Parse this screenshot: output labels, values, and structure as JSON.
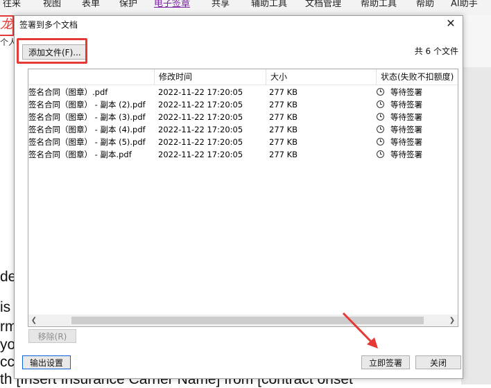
{
  "background": {
    "menu": [
      "往来",
      "视图",
      "表单",
      "保护",
      "电子签章",
      "共享",
      "辅助工具",
      "文档管理",
      "帮助工具",
      "帮助",
      "AI助手"
    ],
    "active_menu": "电子签章",
    "logo_char": "龙",
    "side_text": "个人",
    "doc_lines": [
      "de",
      "is t",
      "rm",
      "yo",
      "cc",
      "th [Insert Insurance Carrier Name] from [contract onset"
    ]
  },
  "dialog": {
    "title": "签署到多个文档",
    "add_file_label": "添加文件(F)...",
    "file_count": "共 6 个文件",
    "columns": [
      "",
      "修改时间",
      "大小",
      "状态(失败不扣额度)"
    ],
    "files": [
      {
        "name": "签名合同（图章）.pdf",
        "mtime": "2022-11-22 17:20:05",
        "size": "277 KB",
        "status": "等待签署"
      },
      {
        "name": "签名合同（图章） - 副本 (2).pdf",
        "mtime": "2022-11-22 17:20:05",
        "size": "277 KB",
        "status": "等待签署"
      },
      {
        "name": "签名合同（图章） - 副本 (3).pdf",
        "mtime": "2022-11-22 17:20:05",
        "size": "277 KB",
        "status": "等待签署"
      },
      {
        "name": "签名合同（图章） - 副本 (4).pdf",
        "mtime": "2022-11-22 17:20:05",
        "size": "277 KB",
        "status": "等待签署"
      },
      {
        "name": "签名合同（图章） - 副本 (5).pdf",
        "mtime": "2022-11-22 17:20:05",
        "size": "277 KB",
        "status": "等待签署"
      },
      {
        "name": "签名合同（图章） - 副本.pdf",
        "mtime": "2022-11-22 17:20:05",
        "size": "277 KB",
        "status": "等待签署"
      }
    ],
    "remove_label": "移除(R)",
    "output_settings_label": "输出设置",
    "sign_now_label": "立即签署",
    "close_label": "关闭"
  },
  "colors": {
    "highlight": "#e53935",
    "active_menu": "#7b1fa2"
  }
}
